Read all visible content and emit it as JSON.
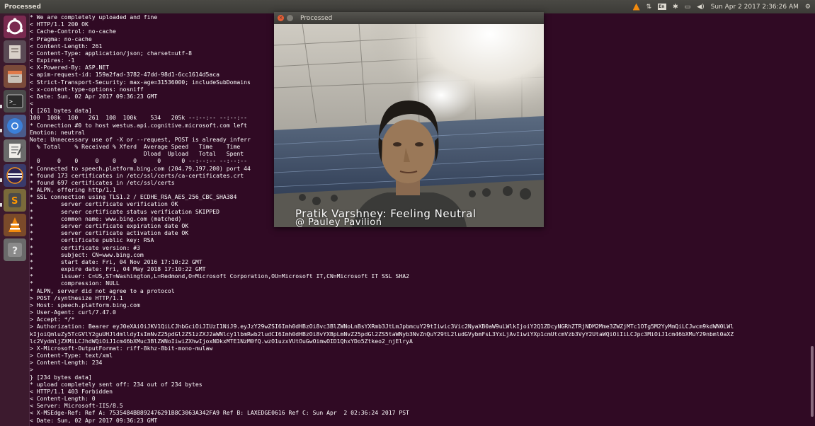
{
  "panel": {
    "app_title": "Processed",
    "language": "En",
    "datetime": "Sun Apr 2 2017 2:36:26 AM"
  },
  "launcher": {
    "items": [
      {
        "name": "ubuntu-dash-icon"
      },
      {
        "name": "files-icon"
      },
      {
        "name": "file-manager-icon"
      },
      {
        "name": "terminal-icon"
      },
      {
        "name": "chromium-icon"
      },
      {
        "name": "text-editor-icon"
      },
      {
        "name": "eclipse-icon"
      },
      {
        "name": "sublime-text-icon"
      },
      {
        "name": "vlc-icon"
      },
      {
        "name": "help-icon"
      }
    ]
  },
  "terminal": {
    "lines": [
      "* We are completely uploaded and fine",
      "< HTTP/1.1 200 OK",
      "< Cache-Control: no-cache",
      "< Pragma: no-cache",
      "< Content-Length: 261",
      "< Content-Type: application/json; charset=utf-8",
      "< Expires: -1",
      "< X-Powered-By: ASP.NET",
      "< apim-request-id: 159a2fad-3782-47dd-98d1-6cc1614d5aca",
      "< Strict-Transport-Security: max-age=31536000; includeSubDomains",
      "< x-content-type-options: nosniff",
      "< Date: Sun, 02 Apr 2017 09:36:23 GMT",
      "<",
      "{ [261 bytes data]",
      "100  100k  100   261  100  100k    534   205k --:--:-- --:--:--",
      "* Connection #0 to host westus.api.cognitive.microsoft.com left",
      "Emotion: neutral",
      "Note: Unnecessary use of -X or --request, POST is already inferr",
      "  % Total    % Received % Xferd  Average Speed   Time    Time",
      "                                 Dload  Upload   Total   Spent",
      "  0     0    0     0    0     0      0      0 --:--:-- --:--:--",
      "* Connected to speech.platform.bing.com (204.79.197.200) port 44",
      "* found 173 certificates in /etc/ssl/certs/ca-certificates.crt",
      "* found 697 certificates in /etc/ssl/certs",
      "* ALPN, offering http/1.1",
      "* SSL connection using TLS1.2 / ECDHE_RSA_AES_256_CBC_SHA384",
      "*        server certificate verification OK",
      "*        server certificate status verification SKIPPED",
      "*        common name: www.bing.com (matched)",
      "*        server certificate expiration date OK",
      "*        server certificate activation date OK",
      "*        certificate public key: RSA",
      "*        certificate version: #3",
      "*        subject: CN=www.bing.com",
      "*        start date: Fri, 04 Nov 2016 17:10:22 GMT",
      "*        expire date: Fri, 04 May 2018 17:10:22 GMT",
      "*        issuer: C=US,ST=Washington,L=Redmond,O=Microsoft Corporation,OU=Microsoft IT,CN=Microsoft IT SSL SHA2",
      "*        compression: NULL",
      "* ALPN, server did not agree to a protocol",
      "> POST /synthesize HTTP/1.1",
      "> Host: speech.platform.bing.com",
      "> User-Agent: curl/7.47.0",
      "> Accept: */*",
      "> Authorization: Bearer eyJ0eXAiOiJKV1QiLCJhbGciOiJIUzI1NiJ9.eyJzY29wZSI6Imh0dHBzOi8vc3BlZWNoLnBsYXRmb3JtLmJpbmcuY29tIiwic3Vic2NyaXB0aW9uLWlkIjoiY2Q1ZDcyNGRhZTRjNDM2Mme3ZWZjMTc1OTg5M2YyMmQiLCJwcm9kdWN0LWl",
      "kIjoiQmluZy5TcGVlY2guUHJldmlldyIsImNvZ25pdGl2ZS1zZXJ2aWNlcy1lbmRwb2ludCI6Imh0dHBzOi8vYXBpLmNvZ25pdGl2ZS5taWNyb3NvZnQuY29tL2ludGVybmFsL3YxLjAvIiwiYXp1cmUtcmVzb3VyY2UtaWQiOiIiLCJpc3MiOiJ1cm46bXMuY29nbml0aXZ",
      "lc2VydmljZXMiLCJhdWQiOiJ1cm46bXMuc3BlZWNoIiwiZXhwIjoxNDkxMTE1NzM0fQ.wzO1uzxVUtOuGwOimwOID1QhxYDo5Ztkeo2_njElryA",
      "> X-Microsoft-OutputFormat: riff-8khz-8bit-mono-mulaw",
      "> Content-Type: text/xml",
      "> Content-Length: 234",
      ">",
      "} [234 bytes data]",
      "* upload completely sent off: 234 out of 234 bytes",
      "< HTTP/1.1 403 Forbidden",
      "< Content-Length: 0",
      "< Server: Microsoft-IIS/8.5",
      "< X-MSEdge-Ref: Ref A: 7535484BB892476291B8C3063A342FA9 Ref B: LAXEDGE0616 Ref C: Sun Apr  2 02:36:24 2017 PST",
      "< Date: Sun, 02 Apr 2017 09:36:23 GMT"
    ]
  },
  "window": {
    "title": "Processed",
    "overlay_line1": "Pratik Varshney: Feeling Neutral",
    "overlay_line2": "@ Pauley Pavilion"
  },
  "colors": {
    "terminal_bg": "#300a24",
    "panel_bg": "#3c3b37",
    "close_button": "#e85d34"
  }
}
